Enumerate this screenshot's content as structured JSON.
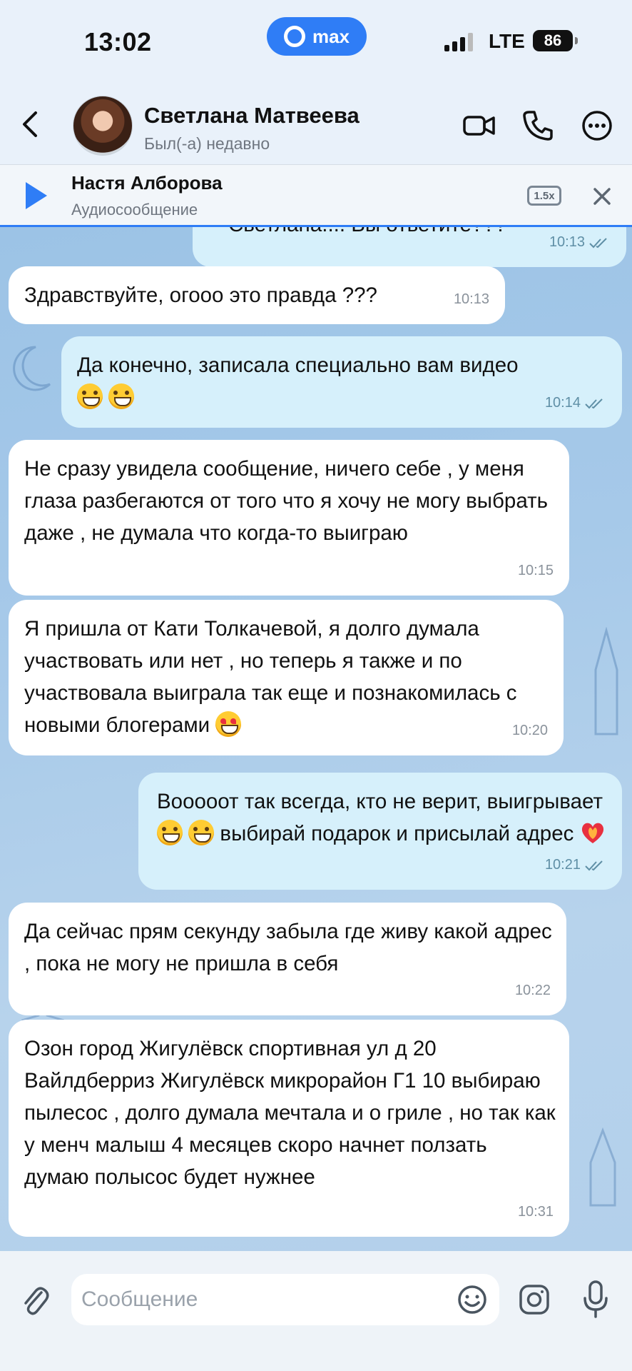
{
  "status_bar": {
    "time": "13:02",
    "app_pill": "max",
    "network": "LTE",
    "battery": "86"
  },
  "header": {
    "name": "Светлана Матвеева",
    "status": "Был(-а) недавно"
  },
  "audio_bar": {
    "sender": "Настя Алборова",
    "label": "Аудиосообщение",
    "speed": "1.5x"
  },
  "messages": [
    {
      "dir": "out",
      "text": "Светлана.... Вы ответите???",
      "time": "10:13"
    },
    {
      "dir": "in",
      "text": "Здравствуйте, огооо это правда ???",
      "time": "10:13"
    },
    {
      "dir": "out",
      "text": "Да конечно, записала специально вам видео",
      "emoji": "grin x2",
      "time": "10:14"
    },
    {
      "dir": "in",
      "text": "Не сразу увидела сообщение, ничего себе , у меня глаза разбегаются от того что я хочу не могу выбрать даже , не думала что когда-то выиграю",
      "time": "10:15"
    },
    {
      "dir": "in",
      "text": "Я пришла от Кати Толкачевой, я долго думала участвовать или нет , но теперь я также и по участвовала выиграла так еще и познакомилась с новыми блогерами",
      "emoji": "heart-eyes",
      "time": "10:20"
    },
    {
      "dir": "out",
      "text_a": "Вооооот так всегда, кто не верит, выигрывает",
      "text_b": "выбирай подарок и присылай адрес",
      "emoji": "grin x2, heart-on-fire",
      "time": "10:21"
    },
    {
      "dir": "in",
      "text": "Да сейчас прям секунду забыла где живу какой адрес , пока не могу не пришла в себя",
      "time": "10:22"
    },
    {
      "dir": "in",
      "text": "Озон город Жигулёвск спортивная ул д 20 Вайлдберриз Жигулёвск микрорайон Г1 10 выбираю пылесос , долго думала мечтала и о гриле , но так как у менч малыш 4 месяцев скоро начнет ползать думаю полысос будет нужнее",
      "time": "10:31"
    }
  ],
  "input": {
    "placeholder": "Сообщение"
  },
  "colors": {
    "accent": "#2f7df6",
    "incoming_bubble": "#ffffff",
    "outgoing_bubble": "#d6f0fb",
    "chat_background": "#a6c9e9"
  }
}
